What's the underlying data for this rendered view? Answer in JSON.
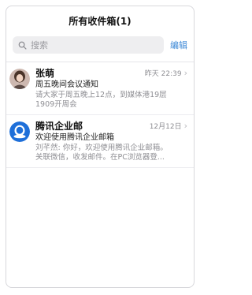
{
  "header": {
    "title": "所有收件箱(1)"
  },
  "search": {
    "placeholder": "搜索",
    "edit_label": "编辑"
  },
  "mails": [
    {
      "sender": "张萌",
      "time": "昨天 22:39",
      "subject": "周五晚间会议通知",
      "preview_line1": "请大家于周五晚上12点，到媒体港19层",
      "preview_line2": "1909开周会"
    },
    {
      "sender": "腾讯企业邮",
      "time": "12月12日",
      "subject": "欢迎使用腾讯企业邮箱",
      "preview_line1": "刘芊然: 你好，欢迎使用腾讯企业邮箱。",
      "preview_line2": "关联微信，收发邮件。在PC浏览器登..."
    }
  ],
  "colors": {
    "accent": "#3a87d6",
    "avatar_blue": "#1e6fd9"
  }
}
